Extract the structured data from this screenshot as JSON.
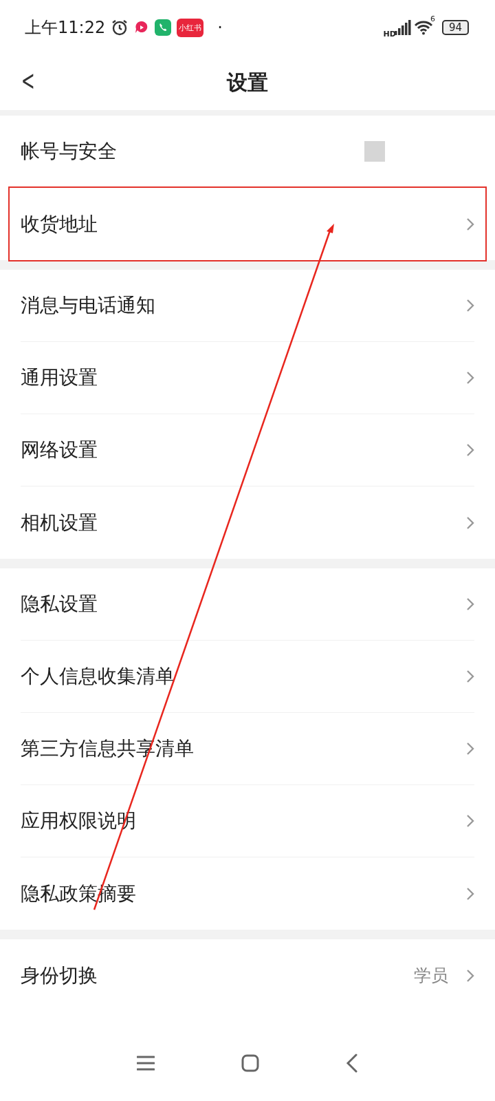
{
  "status_bar": {
    "time": "上午11:22",
    "app_badge": "小红书",
    "dot": "·",
    "network": "HD",
    "wifi_gen": "6",
    "battery": "94"
  },
  "header": {
    "back": "<",
    "title": "设置"
  },
  "groups": [
    {
      "items": [
        {
          "label": "帐号与安全",
          "kind": "masked",
          "highlighted": false
        },
        {
          "label": "收货地址",
          "kind": "link",
          "highlighted": true
        }
      ]
    },
    {
      "items": [
        {
          "label": "消息与电话通知",
          "kind": "link",
          "highlighted": false
        },
        {
          "label": "通用设置",
          "kind": "link",
          "highlighted": false
        },
        {
          "label": "网络设置",
          "kind": "link",
          "highlighted": false
        },
        {
          "label": "相机设置",
          "kind": "link",
          "highlighted": false
        }
      ]
    },
    {
      "items": [
        {
          "label": "隐私设置",
          "kind": "link",
          "highlighted": false
        },
        {
          "label": "个人信息收集清单",
          "kind": "link",
          "highlighted": false
        },
        {
          "label": "第三方信息共享清单",
          "kind": "link",
          "highlighted": false
        },
        {
          "label": "应用权限说明",
          "kind": "link",
          "highlighted": false
        },
        {
          "label": "隐私政策摘要",
          "kind": "link",
          "highlighted": false
        }
      ]
    },
    {
      "items": [
        {
          "label": "身份切换",
          "kind": "link",
          "value": "学员",
          "highlighted": false
        }
      ]
    }
  ]
}
